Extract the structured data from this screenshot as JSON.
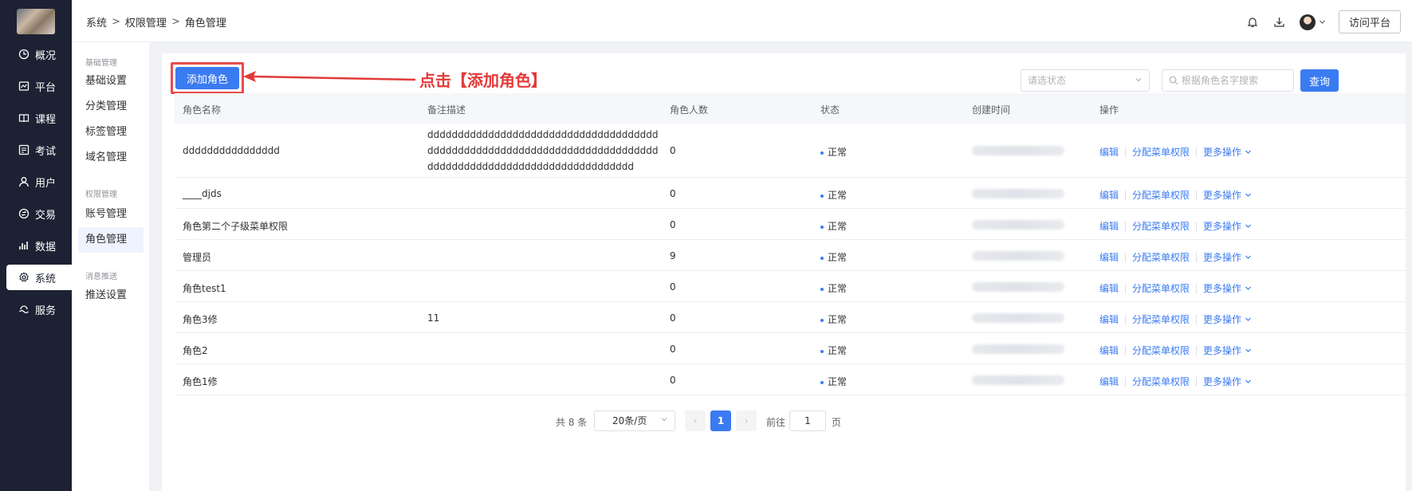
{
  "breadcrumb": [
    "系统",
    "权限管理",
    "角色管理"
  ],
  "breadcrumb_sep": ">",
  "header": {
    "visit_label": "访问平台",
    "icons": [
      "bell-icon",
      "download-icon",
      "avatar",
      "chevron-down-icon"
    ]
  },
  "nav": [
    {
      "label": "概况",
      "icon": "dashboard-icon"
    },
    {
      "label": "平台",
      "icon": "platform-icon"
    },
    {
      "label": "课程",
      "icon": "book-icon"
    },
    {
      "label": "考试",
      "icon": "exam-icon"
    },
    {
      "label": "用户",
      "icon": "user-icon"
    },
    {
      "label": "交易",
      "icon": "transaction-icon"
    },
    {
      "label": "数据",
      "icon": "chart-icon"
    },
    {
      "label": "系统",
      "icon": "gear-icon",
      "active": true
    },
    {
      "label": "服务",
      "icon": "service-icon"
    }
  ],
  "subnav": {
    "groups": [
      {
        "title": "基础管理",
        "items": [
          "基础设置",
          "分类管理",
          "标签管理",
          "域名管理"
        ]
      },
      {
        "title": "权限管理",
        "items": [
          "账号管理",
          "角色管理"
        ]
      },
      {
        "title": "消息推送",
        "items": [
          "推送设置"
        ]
      }
    ],
    "active": "角色管理"
  },
  "toolbar": {
    "add_label": "添加角色",
    "annotation": "点击【添加角色】",
    "status_placeholder": "请选状态",
    "search_placeholder": "根据角色名字搜索",
    "query_label": "查询"
  },
  "table": {
    "columns": [
      "角色名称",
      "备注描述",
      "角色人数",
      "状态",
      "创建时间",
      "操作"
    ],
    "rows": [
      {
        "name": "dddddddddddddddd",
        "desc": "dddddddddddddddddddddddddddddddddddddddddddddddddddddddddddddddddddddddddddddddddddddddddddddddddddddddddddddd",
        "count": "0",
        "status": "正常"
      },
      {
        "name": "____djds",
        "desc": "",
        "count": "0",
        "status": "正常"
      },
      {
        "name": "角色第二个子级菜单权限",
        "desc": "",
        "count": "0",
        "status": "正常"
      },
      {
        "name": "管理员",
        "desc": "",
        "count": "9",
        "status": "正常"
      },
      {
        "name": "角色test1",
        "desc": "",
        "count": "0",
        "status": "正常"
      },
      {
        "name": "角色3修",
        "desc": "11",
        "count": "0",
        "status": "正常"
      },
      {
        "name": "角色2",
        "desc": "",
        "count": "0",
        "status": "正常"
      },
      {
        "name": "角色1修",
        "desc": "",
        "count": "0",
        "status": "正常"
      }
    ],
    "ops": {
      "edit": "编辑",
      "assign": "分配菜单权限",
      "more": "更多操作"
    }
  },
  "pagination": {
    "total_label": "共 8 条",
    "page_size": "20条/页",
    "prev": "‹",
    "next": "›",
    "current": "1",
    "goto_label": "前往",
    "goto_value": "1",
    "page_unit": "页"
  },
  "colors": {
    "primary": "#3a7bf2",
    "annotation": "#e23a3a",
    "nav_bg": "#1c2233"
  }
}
